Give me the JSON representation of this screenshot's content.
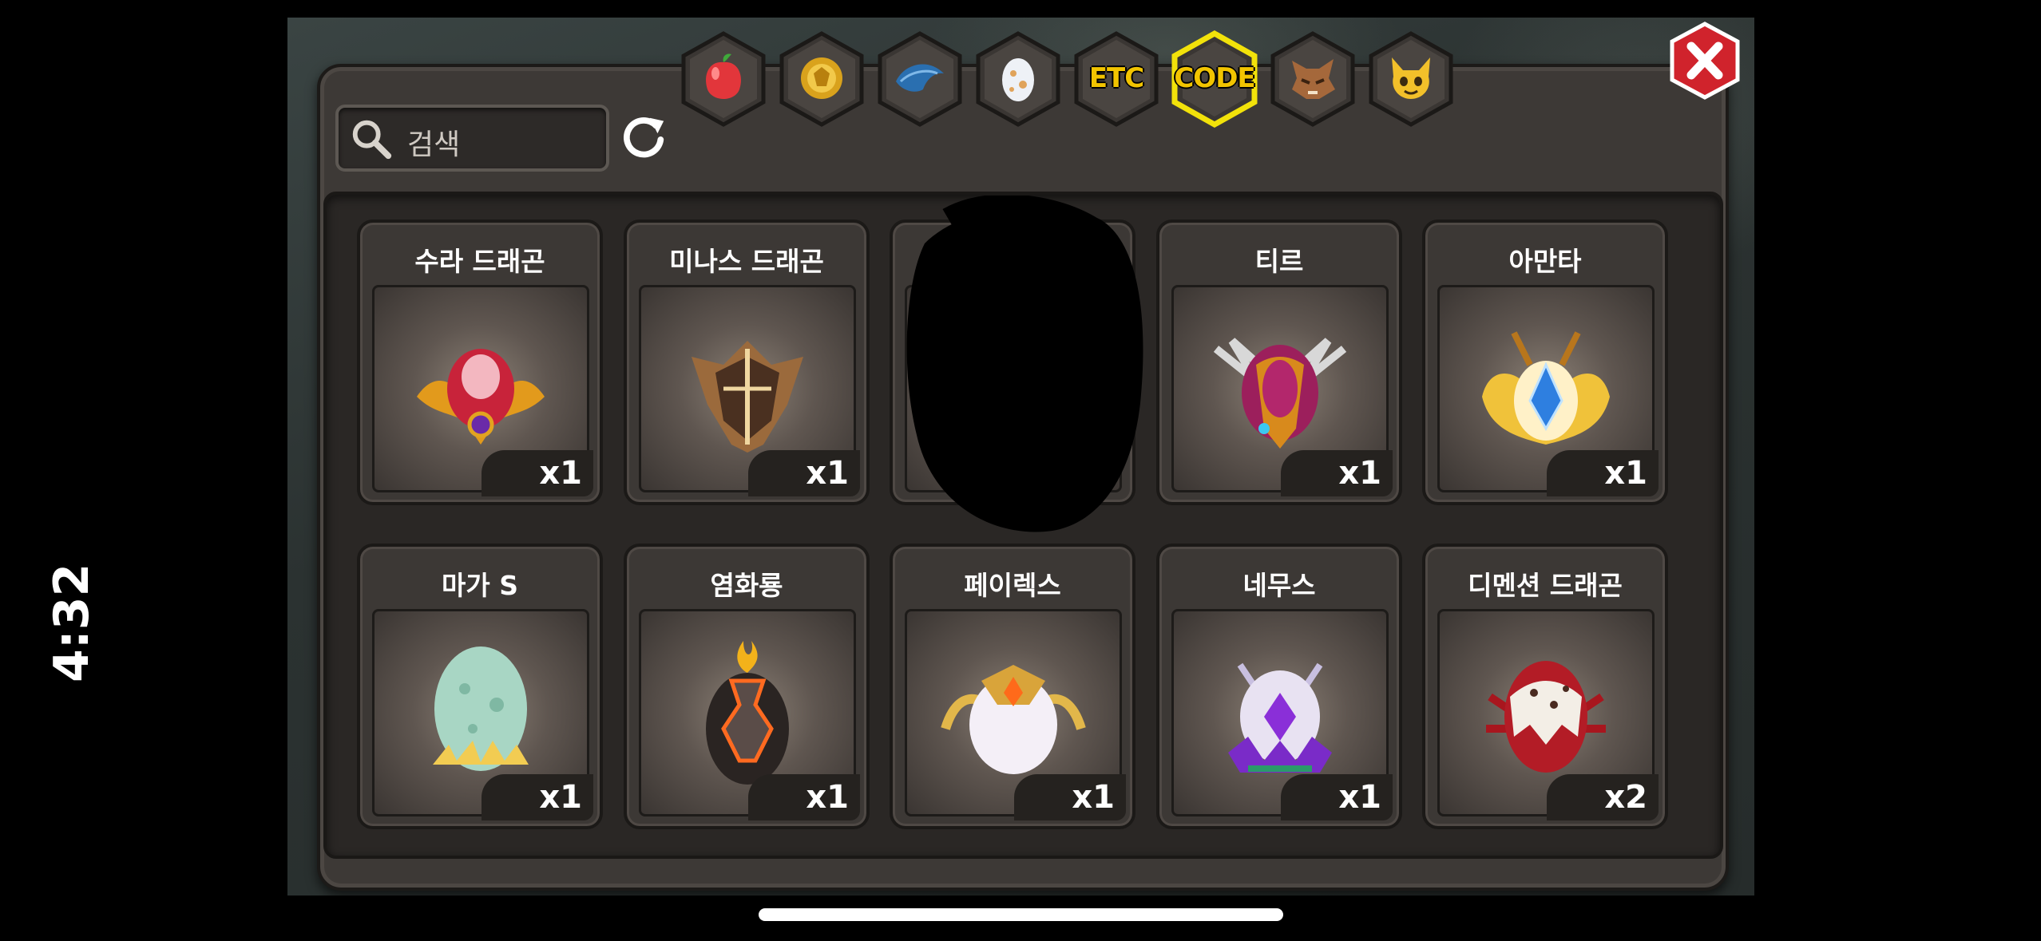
{
  "status_bar": {
    "time": "4:32"
  },
  "search": {
    "placeholder": "검색"
  },
  "tabs": [
    {
      "id": "fruit",
      "icon": "fruit-icon"
    },
    {
      "id": "gold",
      "icon": "gold-coin-icon"
    },
    {
      "id": "feather",
      "icon": "blue-feather-icon"
    },
    {
      "id": "egg",
      "icon": "egg-icon"
    },
    {
      "id": "etc",
      "label": "ETC"
    },
    {
      "id": "code",
      "label": "CODE",
      "selected": true
    },
    {
      "id": "beast",
      "icon": "wolf-head-icon"
    },
    {
      "id": "creature",
      "icon": "yellow-creature-icon"
    }
  ],
  "items": [
    {
      "name": "수라 드래곤",
      "qty": "x1",
      "icon": "crimson-gold-egg-icon"
    },
    {
      "name": "미나스 드래곤",
      "qty": "x1",
      "icon": "bronze-helmet-egg-icon"
    },
    {
      "name": "",
      "qty": "",
      "icon": "redacted"
    },
    {
      "name": "티르",
      "qty": "x1",
      "icon": "magenta-winged-egg-icon"
    },
    {
      "name": "아만타",
      "qty": "x1",
      "icon": "golden-crystal-egg-icon"
    },
    {
      "name": "마가 S",
      "qty": "x1",
      "icon": "mint-egg-icon"
    },
    {
      "name": "염화룡",
      "qty": "x1",
      "icon": "lava-egg-icon"
    },
    {
      "name": "페이렉스",
      "qty": "x1",
      "icon": "white-gold-egg-icon"
    },
    {
      "name": "네무스",
      "qty": "x1",
      "icon": "purple-crystal-egg-icon"
    },
    {
      "name": "디멘션 드래곤",
      "qty": "x2",
      "icon": "spotted-red-egg-icon"
    }
  ],
  "colors": {
    "accent": "#f2d000",
    "panel": "#3d3936",
    "close": "#d0232c"
  }
}
